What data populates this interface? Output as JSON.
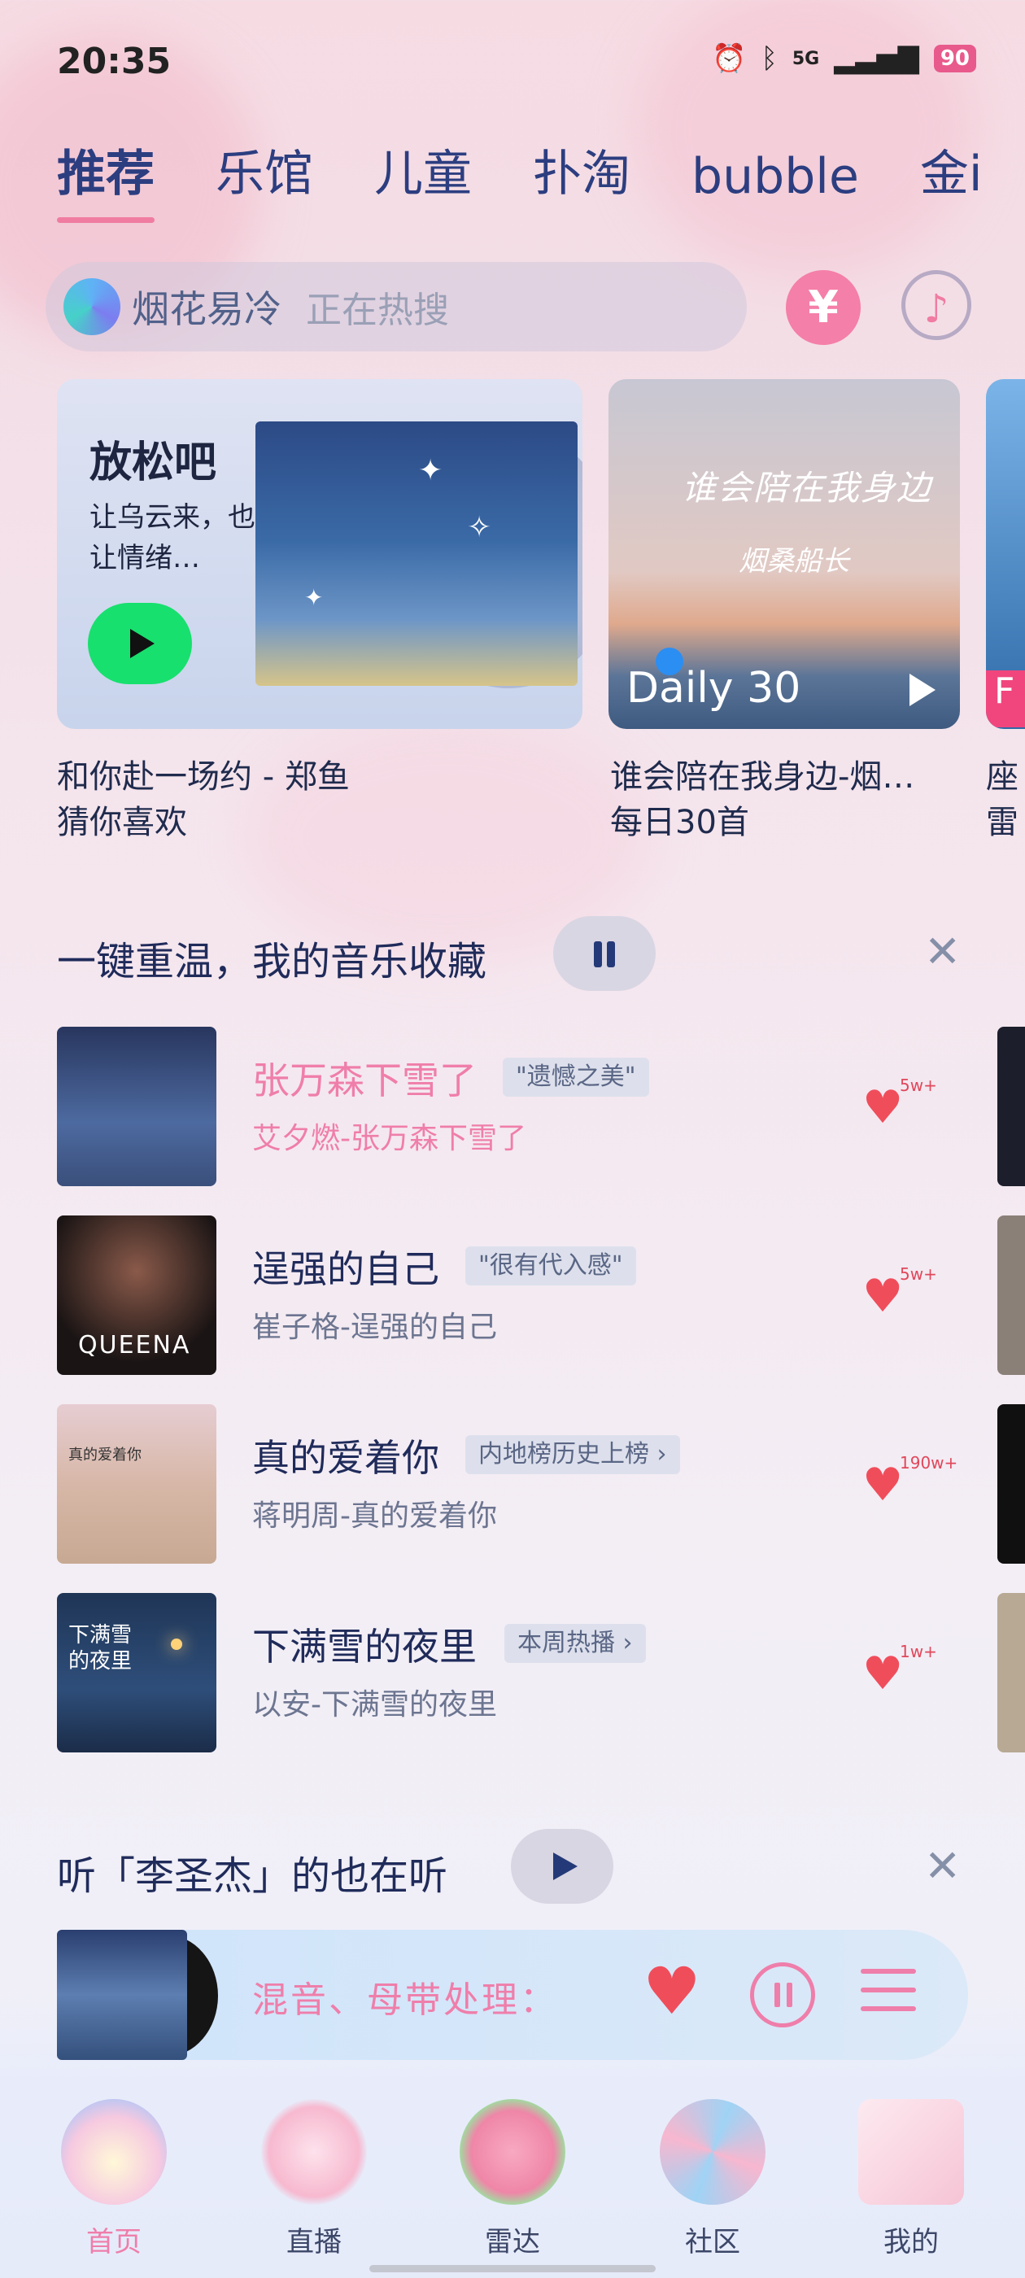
{
  "status": {
    "time": "20:35",
    "network": "5G",
    "battery": "90"
  },
  "tabs": [
    "推荐",
    "乐馆",
    "儿童",
    "扑淘",
    "bubble",
    "金i"
  ],
  "search": {
    "query": "烟花易冷",
    "hint": "正在热搜",
    "vip_symbol": "¥",
    "music_symbol": "♪"
  },
  "cards": [
    {
      "headline": "放松吧",
      "subtitle": "让乌云来，也让情绪…",
      "caption_title": "和你赴一场约 - 郑鱼",
      "caption_sub": "猜你喜欢"
    },
    {
      "art_line1": "谁会陪在我身边",
      "art_line2": "烟桑船长",
      "badge": "Daily 30",
      "caption_title": "谁会陪在我身边-烟…",
      "caption_sub": "每日30首"
    },
    {
      "badge": "F",
      "caption_title": "座",
      "caption_sub": "雷"
    }
  ],
  "section1": {
    "title": "一键重温，我的音乐收藏"
  },
  "songs": [
    {
      "title": "张万森下雪了",
      "tag": "\"遗憾之美\"",
      "subtitle": "艾夕燃-张万森下雪了",
      "likes": "5w+"
    },
    {
      "title": "逞强的自己",
      "tag": "\"很有代入感\"",
      "subtitle": "崔子格-逞强的自己",
      "likes": "5w+",
      "cover_text": "QUEENA"
    },
    {
      "title": "真的爱着你",
      "tag": "内地榜历史上榜 ›",
      "subtitle": "蒋明周-真的爱着你",
      "likes": "190w+",
      "cover_text": "真的爱着你"
    },
    {
      "title": "下满雪的夜里",
      "tag": "本周热播 ›",
      "subtitle": "以安-下满雪的夜里",
      "likes": "1w+",
      "cover_text": "下满雪的夜里"
    }
  ],
  "section2": {
    "title": "听「李圣杰」的也在听"
  },
  "player": {
    "now_playing": "混音、母带处理："
  },
  "nav": [
    {
      "label": "首页",
      "icon": "butterfly-icon"
    },
    {
      "label": "直播",
      "icon": "paper-crane-icon"
    },
    {
      "label": "雷达",
      "icon": "flower-icon"
    },
    {
      "label": "社区",
      "icon": "fan-icon"
    },
    {
      "label": "我的",
      "icon": "envelope-icon"
    }
  ],
  "colors": {
    "accent_pink": "#ef7eaa",
    "heart_red": "#f04d5b",
    "play_green": "#18e06e"
  }
}
